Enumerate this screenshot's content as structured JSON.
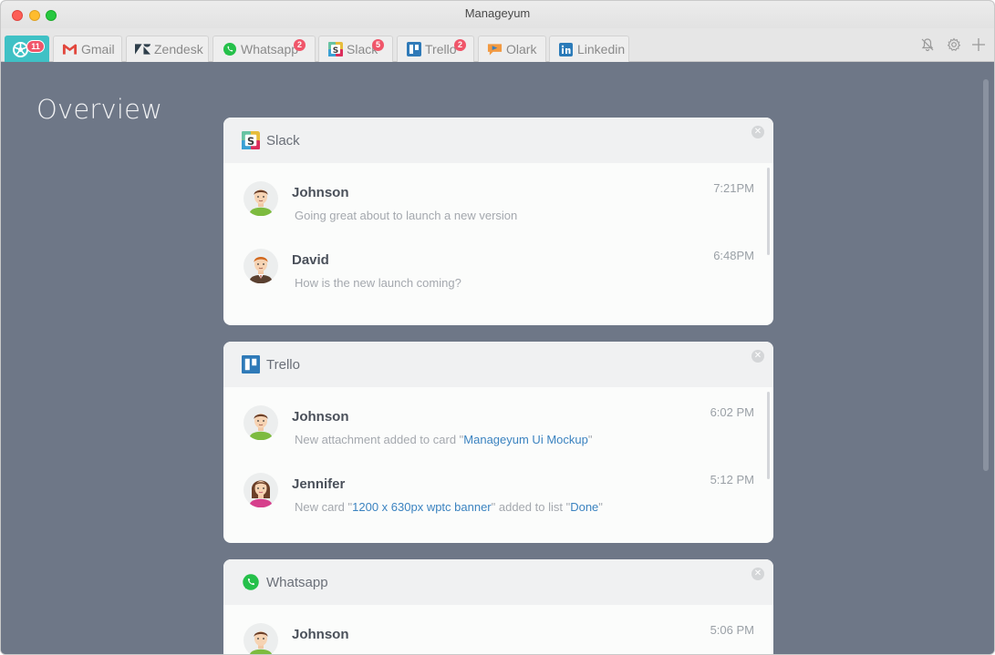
{
  "window": {
    "title": "Manageyum"
  },
  "tabs": [
    {
      "name": "home",
      "label": "",
      "badge": "11"
    },
    {
      "name": "gmail",
      "label": "Gmail",
      "badge": ""
    },
    {
      "name": "zendesk",
      "label": "Zendesk",
      "badge": ""
    },
    {
      "name": "whatsapp",
      "label": "Whatsapp",
      "badge": "2"
    },
    {
      "name": "slack",
      "label": "Slack",
      "badge": "5"
    },
    {
      "name": "trello",
      "label": "Trello",
      "badge": "2"
    },
    {
      "name": "olark",
      "label": "Olark",
      "badge": ""
    },
    {
      "name": "linkedin",
      "label": "Linkedin",
      "badge": ""
    }
  ],
  "toolbar_icons": [
    "bell-mute-icon",
    "gear-icon",
    "plus-icon"
  ],
  "main": {
    "heading": "Overview"
  },
  "cards": [
    {
      "service": "Slack",
      "messages": [
        {
          "name": "Johnson",
          "time": "7:21PM",
          "text_parts": [
            "Going great about to launch a new version"
          ]
        },
        {
          "name": "David",
          "time": "6:48PM",
          "text_parts": [
            "How is the new launch coming?"
          ]
        }
      ]
    },
    {
      "service": "Trello",
      "messages": [
        {
          "name": "Johnson",
          "time": "6:02 PM",
          "text_parts": [
            "New attachment added to card \"",
            "Manageyum Ui Mockup",
            "\""
          ]
        },
        {
          "name": "Jennifer",
          "time": "5:12 PM",
          "text_parts": [
            "New card \"",
            "1200 x 630px wptc banner",
            "\" added to list \"",
            "Done",
            "\""
          ]
        }
      ]
    },
    {
      "service": "Whatsapp",
      "messages": [
        {
          "name": "Johnson",
          "time": "5:06 PM",
          "text_parts": []
        }
      ]
    }
  ],
  "colors": {
    "accent": "#3fc1c5",
    "badge": "#f0566a",
    "background": "#6e7787",
    "link": "#3b83c0"
  }
}
